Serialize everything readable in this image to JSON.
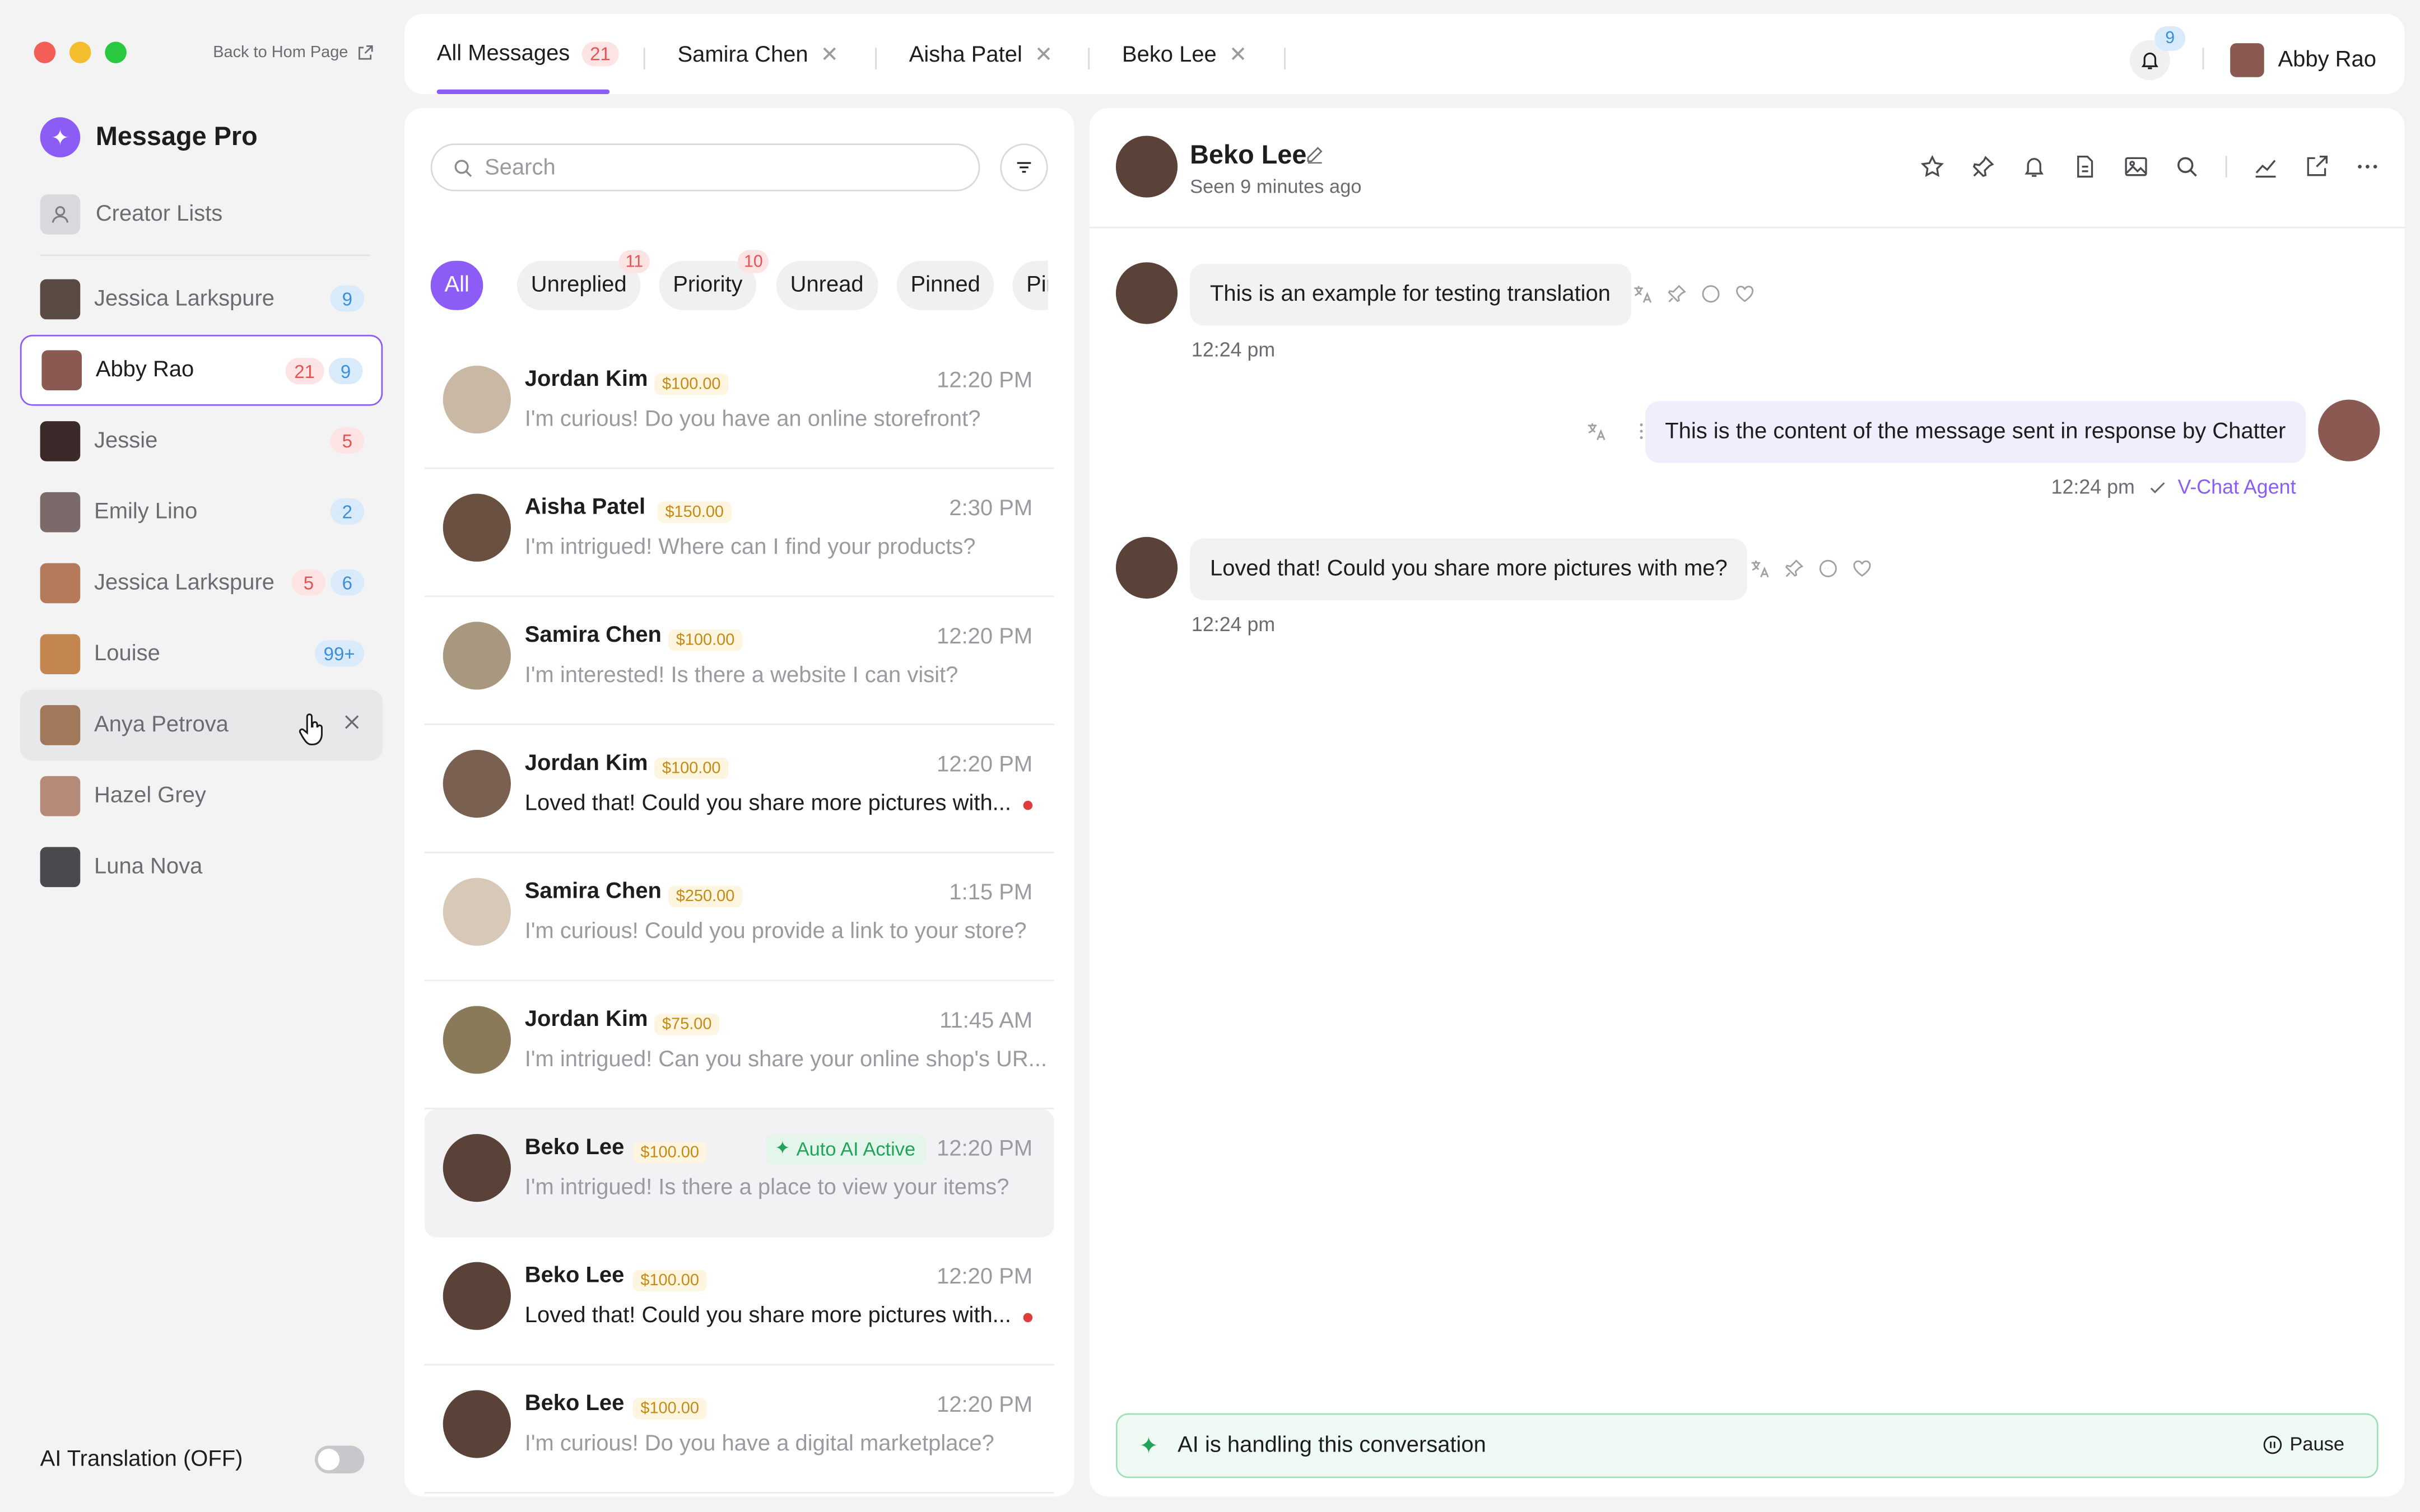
{
  "window": {
    "back_link": "Back to Hom Page"
  },
  "brand": {
    "name": "Message Pro",
    "logo_glyph": "✦"
  },
  "sidebar": {
    "creator_lists": "Creator Lists",
    "items": [
      {
        "name": "Jessica Larkspure",
        "badges": [
          {
            "text": "9",
            "type": "blue"
          }
        ],
        "color": "#5a4a44"
      },
      {
        "name": "Abby Rao",
        "badges": [
          {
            "text": "21",
            "type": "red"
          },
          {
            "text": "9",
            "type": "blue"
          }
        ],
        "color": "#8a5a52"
      },
      {
        "name": "Jessie",
        "badges": [
          {
            "text": "5",
            "type": "red"
          }
        ],
        "color": "#3a2a2a"
      },
      {
        "name": "Emily Lino",
        "badges": [
          {
            "text": "2",
            "type": "blue"
          }
        ],
        "color": "#7a6a6a"
      },
      {
        "name": "Jessica Larkspure",
        "badges": [
          {
            "text": "5",
            "type": "red"
          },
          {
            "text": "6",
            "type": "blue"
          }
        ],
        "color": "#b47a5a"
      },
      {
        "name": "Louise",
        "badges": [
          {
            "text": "99+",
            "type": "blue"
          }
        ],
        "color": "#c4864f"
      },
      {
        "name": "Anya Petrova",
        "badges": [],
        "color": "#a2785a"
      },
      {
        "name": "Hazel Grey",
        "badges": [],
        "color": "#b58a78"
      },
      {
        "name": "Luna Nova",
        "badges": [],
        "color": "#4a4a4e"
      }
    ],
    "ai_translation": "AI Translation (OFF)"
  },
  "tabs": [
    {
      "label": "All Messages",
      "count": "21"
    },
    {
      "label": "Samira Chen"
    },
    {
      "label": "Aisha Patel"
    },
    {
      "label": "Beko Lee"
    }
  ],
  "topbar": {
    "notif_count": "9",
    "user_name": "Abby Rao"
  },
  "list": {
    "search_placeholder": "Search",
    "chips": [
      {
        "label": "All",
        "badge": ""
      },
      {
        "label": "Unreplied",
        "badge": "11"
      },
      {
        "label": "Priority",
        "badge": "10"
      },
      {
        "label": "Unread",
        "badge": ""
      },
      {
        "label": "Pinned",
        "badge": ""
      },
      {
        "label": "Pinned",
        "badge": ""
      }
    ],
    "rows": [
      {
        "name": "Jordan Kim",
        "price": "$100.00",
        "time": "12:20 PM",
        "msg": "I'm curious! Do you have an online storefront?",
        "unread": false,
        "color": "#c9b9a4"
      },
      {
        "name": "Aisha Patel",
        "price": "$150.00",
        "time": "2:30 PM",
        "msg": "I'm intrigued! Where can I find your products?",
        "unread": false,
        "color": "#6a5040"
      },
      {
        "name": "Samira Chen",
        "price": "$100.00",
        "time": "12:20 PM",
        "msg": "I'm interested! Is there a website I can visit?",
        "unread": false,
        "color": "#a89880"
      },
      {
        "name": "Jordan Kim",
        "price": "$100.00",
        "time": "12:20 PM",
        "msg": "Loved that! Could you share more pictures with...",
        "unread": true,
        "color": "#7a6050"
      },
      {
        "name": "Samira Chen",
        "price": "$250.00",
        "time": "1:15 PM",
        "msg": "I'm curious! Could you provide a link to your store?",
        "unread": false,
        "color": "#d8c8b8"
      },
      {
        "name": "Jordan Kim",
        "price": "$75.00",
        "time": "11:45 AM",
        "msg": "I'm intrigued! Can you share your online shop's UR...",
        "unread": false,
        "color": "#8a7a5a"
      },
      {
        "name": "Beko Lee",
        "price": "$100.00",
        "time": "12:20 PM",
        "msg": "I'm intrigued! Is there a place to view your items?",
        "unread": false,
        "ai": "Auto AI Active",
        "color": "#5a4238"
      },
      {
        "name": "Beko Lee",
        "price": "$100.00",
        "time": "12:20 PM",
        "msg": "Loved that! Could you share more pictures with...",
        "unread": true,
        "color": "#5a4238"
      },
      {
        "name": "Beko Lee",
        "price": "$100.00",
        "time": "12:20 PM",
        "msg": "I'm curious! Do you have a digital marketplace?",
        "unread": false,
        "color": "#5a4238"
      }
    ]
  },
  "chat": {
    "name": "Beko Lee",
    "seen": "Seen 9 minutes ago",
    "messages": [
      {
        "text": "This is an example for testing translation",
        "time": "12:24 pm"
      },
      {
        "text": "This is the content of the message sent in response by Chatter",
        "time": "12:24 pm",
        "agent": "V-Chat Agent"
      },
      {
        "text": "Loved that! Could you share more pictures with me?",
        "time": "12:24 pm"
      }
    ],
    "ai_bar": "AI is handling this conversation",
    "pause": "Pause"
  },
  "colors": {
    "accent": "#8b5cf6",
    "success": "#22a35a",
    "danger": "#e25555"
  }
}
